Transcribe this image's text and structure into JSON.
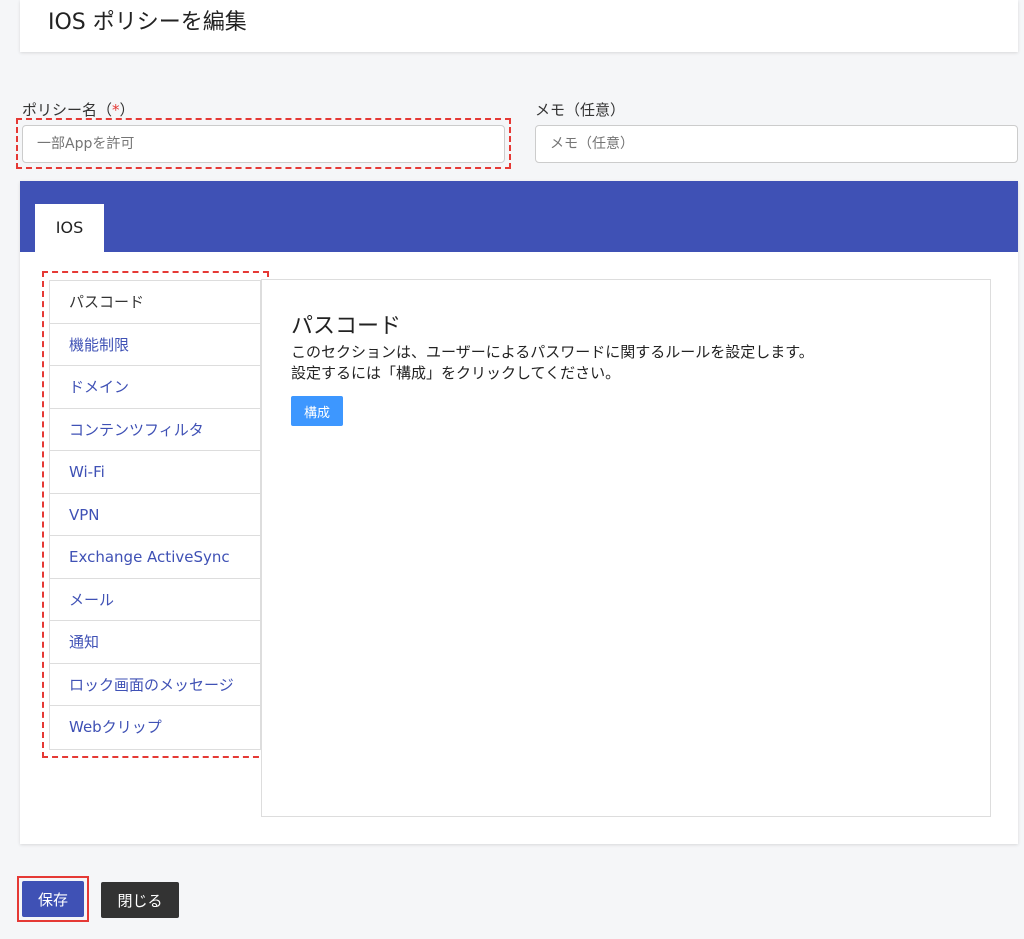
{
  "header": {
    "title": "IOS ポリシーを編集"
  },
  "form": {
    "policy_name_label": "ポリシー名（",
    "required_mark": "*",
    "policy_name_label_end": "）",
    "policy_name_placeholder": "一部Appを許可",
    "memo_label": "メモ（任意）",
    "memo_placeholder": "メモ（任意）"
  },
  "tabs": [
    {
      "label": "IOS"
    }
  ],
  "sidebar": {
    "items": [
      {
        "label": "パスコード",
        "active": true
      },
      {
        "label": "機能制限"
      },
      {
        "label": "ドメイン"
      },
      {
        "label": "コンテンツフィルタ"
      },
      {
        "label": "Wi-Fi"
      },
      {
        "label": "VPN"
      },
      {
        "label": "Exchange ActiveSync"
      },
      {
        "label": "メール"
      },
      {
        "label": "通知"
      },
      {
        "label": "ロック画面のメッセージ"
      },
      {
        "label": "Webクリップ"
      }
    ]
  },
  "content": {
    "title": "パスコード",
    "description_line1": "このセクションは、ユーザーによるパスワードに関するルールを設定します。",
    "description_line2": "設定するには「構成」をクリックしてください。",
    "config_button": "構成"
  },
  "footer": {
    "save_label": "保存",
    "close_label": "閉じる"
  },
  "colors": {
    "primary": "#3f51b5",
    "accent_blue": "#3d97ff",
    "highlight_red": "#e53935",
    "dark_button": "#333333"
  }
}
